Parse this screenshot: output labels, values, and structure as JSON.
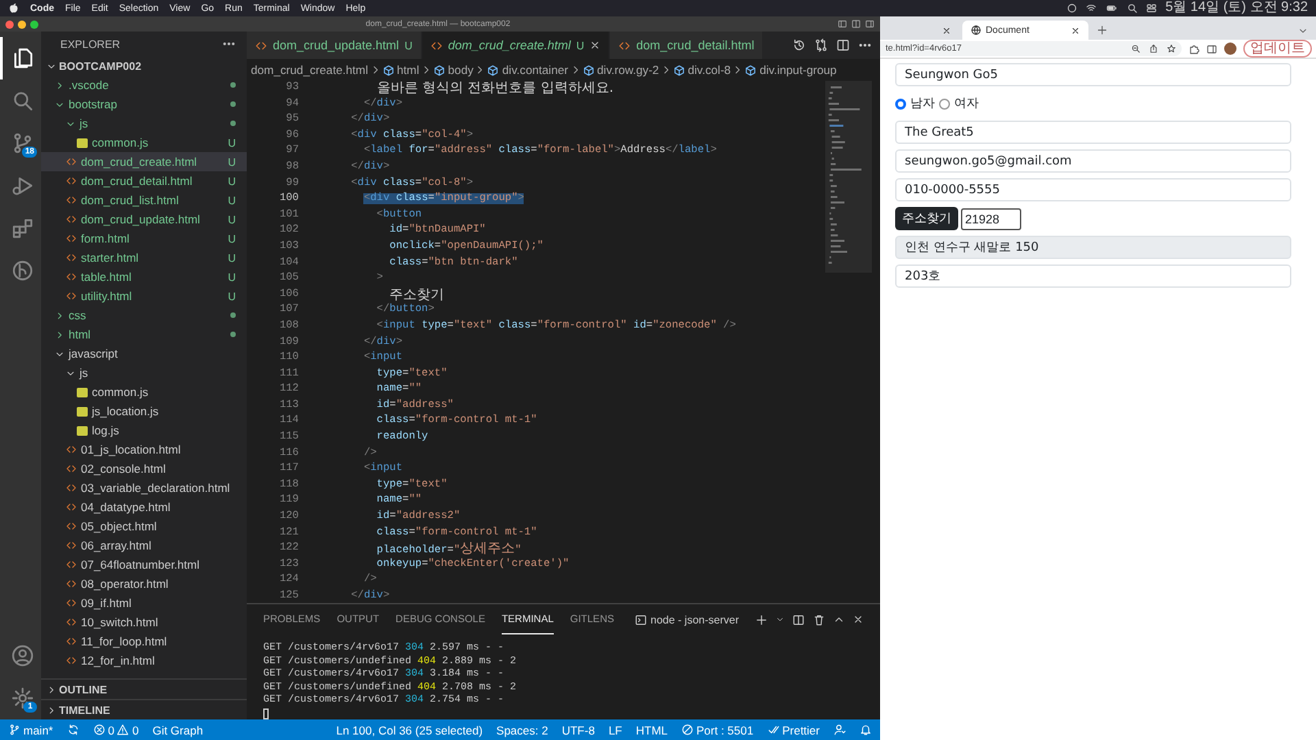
{
  "menubar": {
    "items": [
      "Code",
      "File",
      "Edit",
      "Selection",
      "View",
      "Go",
      "Run",
      "Terminal",
      "Window",
      "Help"
    ],
    "clock": "5월 14일 (토) 오전 9:32"
  },
  "window": {
    "title": "dom_crud_create.html — bootcamp002"
  },
  "activity_bar": {
    "items": [
      {
        "kind": "files",
        "selected": true
      },
      {
        "kind": "search",
        "selected": false
      },
      {
        "kind": "source-control",
        "selected": false,
        "badge": "18"
      },
      {
        "kind": "run",
        "selected": false
      },
      {
        "kind": "extensions",
        "selected": false
      },
      {
        "kind": "gitlens",
        "selected": false
      }
    ],
    "bottom": [
      {
        "kind": "account"
      },
      {
        "kind": "settings",
        "badge": "1"
      }
    ]
  },
  "sidebar": {
    "title": "EXPLORER",
    "root": "BOOTCAMP002",
    "tree": [
      {
        "name": ".vscode",
        "kind": "folder",
        "expanded": false,
        "dot": true,
        "selected": false
      },
      {
        "name": "bootstrap",
        "kind": "folder",
        "expanded": true,
        "dot": true,
        "selected": false,
        "children": [
          {
            "name": "js",
            "kind": "folder",
            "expanded": true,
            "dot": true,
            "selected": false,
            "children": [
              {
                "name": "common.js",
                "kind": "js",
                "badge": "U",
                "selected": false
              }
            ]
          },
          {
            "name": "dom_crud_create.html",
            "kind": "html",
            "badge": "U",
            "selected": true
          },
          {
            "name": "dom_crud_detail.html",
            "kind": "html",
            "badge": "U",
            "selected": false
          },
          {
            "name": "dom_crud_list.html",
            "kind": "html",
            "badge": "U",
            "selected": false
          },
          {
            "name": "dom_crud_update.html",
            "kind": "html",
            "badge": "U",
            "selected": false
          },
          {
            "name": "form.html",
            "kind": "html",
            "badge": "U",
            "selected": false
          },
          {
            "name": "starter.html",
            "kind": "html",
            "badge": "U",
            "selected": false
          },
          {
            "name": "table.html",
            "kind": "html",
            "badge": "U",
            "selected": false
          },
          {
            "name": "utility.html",
            "kind": "html",
            "badge": "U",
            "selected": false
          }
        ]
      },
      {
        "name": "css",
        "kind": "folder",
        "expanded": false,
        "dot": true,
        "selected": false
      },
      {
        "name": "html",
        "kind": "folder",
        "expanded": false,
        "dot": true,
        "selected": false
      },
      {
        "name": "javascript",
        "kind": "folder",
        "expanded": true,
        "selected": false,
        "children": [
          {
            "name": "js",
            "kind": "folder",
            "expanded": true,
            "selected": false,
            "children": [
              {
                "name": "common.js",
                "kind": "js",
                "selected": false
              },
              {
                "name": "js_location.js",
                "kind": "js",
                "selected": false
              },
              {
                "name": "log.js",
                "kind": "js",
                "selected": false
              }
            ]
          },
          {
            "name": "01_js_location.html",
            "kind": "html",
            "selected": false
          },
          {
            "name": "02_console.html",
            "kind": "html",
            "selected": false
          },
          {
            "name": "03_variable_declaration.html",
            "kind": "html",
            "selected": false
          },
          {
            "name": "04_datatype.html",
            "kind": "html",
            "selected": false
          },
          {
            "name": "05_object.html",
            "kind": "html",
            "selected": false
          },
          {
            "name": "06_array.html",
            "kind": "html",
            "selected": false
          },
          {
            "name": "07_64floatnumber.html",
            "kind": "html",
            "selected": false
          },
          {
            "name": "08_operator.html",
            "kind": "html",
            "selected": false
          },
          {
            "name": "09_if.html",
            "kind": "html",
            "selected": false
          },
          {
            "name": "10_switch.html",
            "kind": "html",
            "selected": false
          },
          {
            "name": "11_for_loop.html",
            "kind": "html",
            "selected": false
          },
          {
            "name": "12_for_in.html",
            "kind": "html",
            "selected": false
          }
        ]
      }
    ],
    "sections": [
      "OUTLINE",
      "TIMELINE"
    ]
  },
  "editor": {
    "tabs": [
      {
        "label": "dom_crud_update.html",
        "badge": "U",
        "preview": false,
        "selected": false
      },
      {
        "label": "dom_crud_create.html",
        "badge": "U",
        "preview": true,
        "selected": true
      },
      {
        "label": "dom_crud_detail.html",
        "preview": false,
        "selected": false
      }
    ],
    "breadcrumbs": [
      "dom_crud_create.html",
      "html",
      "body",
      "div.container",
      "div.row.gy-2",
      "div.col-8",
      "div.input-group"
    ],
    "lines": [
      {
        "number": "93",
        "selected": false,
        "segments": [
          {
            "kind": "text",
            "text": "          올바른 형식의 전화번호를 입력하세요."
          }
        ]
      },
      {
        "number": "94",
        "selected": false,
        "segments": [
          {
            "kind": "punct",
            "text": "        </"
          },
          {
            "kind": "tag",
            "text": "div"
          },
          {
            "kind": "punct",
            "text": ">"
          }
        ]
      },
      {
        "number": "95",
        "selected": false,
        "segments": [
          {
            "kind": "punct",
            "text": "      </"
          },
          {
            "kind": "tag",
            "text": "div"
          },
          {
            "kind": "punct",
            "text": ">"
          }
        ]
      },
      {
        "number": "96",
        "selected": false,
        "segments": [
          {
            "kind": "punct",
            "text": "      <"
          },
          {
            "kind": "tag",
            "text": "div"
          },
          {
            "kind": "attr",
            "text": " class"
          },
          {
            "kind": "text",
            "text": "="
          },
          {
            "kind": "string",
            "text": "\"col-4\""
          },
          {
            "kind": "punct",
            "text": ">"
          }
        ]
      },
      {
        "number": "97",
        "selected": false,
        "segments": [
          {
            "kind": "punct",
            "text": "        <"
          },
          {
            "kind": "tag",
            "text": "label"
          },
          {
            "kind": "attr",
            "text": " for"
          },
          {
            "kind": "text",
            "text": "="
          },
          {
            "kind": "string",
            "text": "\"address\""
          },
          {
            "kind": "attr",
            "text": " class"
          },
          {
            "kind": "text",
            "text": "="
          },
          {
            "kind": "string",
            "text": "\"form-label\""
          },
          {
            "kind": "punct",
            "text": ">"
          },
          {
            "kind": "text",
            "text": "Address"
          },
          {
            "kind": "punct",
            "text": "</"
          },
          {
            "kind": "tag",
            "text": "label"
          },
          {
            "kind": "punct",
            "text": ">"
          }
        ]
      },
      {
        "number": "98",
        "selected": false,
        "segments": [
          {
            "kind": "punct",
            "text": "      </"
          },
          {
            "kind": "tag",
            "text": "div"
          },
          {
            "kind": "punct",
            "text": ">"
          }
        ]
      },
      {
        "number": "99",
        "selected": false,
        "segments": [
          {
            "kind": "punct",
            "text": "      <"
          },
          {
            "kind": "tag",
            "text": "div"
          },
          {
            "kind": "attr",
            "text": " class"
          },
          {
            "kind": "text",
            "text": "="
          },
          {
            "kind": "string",
            "text": "\"col-8\""
          },
          {
            "kind": "punct",
            "text": ">"
          }
        ]
      },
      {
        "number": "100",
        "selected": true,
        "segments": [
          {
            "kind": "punct",
            "text": "        <"
          },
          {
            "kind": "tag",
            "text": "div"
          },
          {
            "kind": "attr",
            "text": " class"
          },
          {
            "kind": "text",
            "text": "="
          },
          {
            "kind": "string",
            "text": "\"input-group\""
          },
          {
            "kind": "punct",
            "text": ">"
          }
        ]
      },
      {
        "number": "101",
        "selected": false,
        "segments": [
          {
            "kind": "punct",
            "text": "          <"
          },
          {
            "kind": "tag",
            "text": "button"
          }
        ]
      },
      {
        "number": "102",
        "selected": false,
        "segments": [
          {
            "kind": "attr",
            "text": "            id"
          },
          {
            "kind": "text",
            "text": "="
          },
          {
            "kind": "string",
            "text": "\"btnDaumAPI\""
          }
        ]
      },
      {
        "number": "103",
        "selected": false,
        "segments": [
          {
            "kind": "attr",
            "text": "            onclick"
          },
          {
            "kind": "text",
            "text": "="
          },
          {
            "kind": "string",
            "text": "\"openDaumAPI();\""
          }
        ]
      },
      {
        "number": "104",
        "selected": false,
        "segments": [
          {
            "kind": "attr",
            "text": "            class"
          },
          {
            "kind": "text",
            "text": "="
          },
          {
            "kind": "string",
            "text": "\"btn btn-dark\""
          }
        ]
      },
      {
        "number": "105",
        "selected": false,
        "segments": [
          {
            "kind": "punct",
            "text": "          >"
          }
        ]
      },
      {
        "number": "106",
        "selected": false,
        "segments": [
          {
            "kind": "text",
            "text": "            주소찾기"
          }
        ]
      },
      {
        "number": "107",
        "selected": false,
        "segments": [
          {
            "kind": "punct",
            "text": "          </"
          },
          {
            "kind": "tag",
            "text": "button"
          },
          {
            "kind": "punct",
            "text": ">"
          }
        ]
      },
      {
        "number": "108",
        "selected": false,
        "segments": [
          {
            "kind": "punct",
            "text": "          <"
          },
          {
            "kind": "tag",
            "text": "input"
          },
          {
            "kind": "attr",
            "text": " type"
          },
          {
            "kind": "text",
            "text": "="
          },
          {
            "kind": "string",
            "text": "\"text\""
          },
          {
            "kind": "attr",
            "text": " class"
          },
          {
            "kind": "text",
            "text": "="
          },
          {
            "kind": "string",
            "text": "\"form-control\""
          },
          {
            "kind": "attr",
            "text": " id"
          },
          {
            "kind": "text",
            "text": "="
          },
          {
            "kind": "string",
            "text": "\"zonecode\""
          },
          {
            "kind": "punct",
            "text": " />"
          }
        ]
      },
      {
        "number": "109",
        "selected": false,
        "segments": [
          {
            "kind": "punct",
            "text": "        </"
          },
          {
            "kind": "tag",
            "text": "div"
          },
          {
            "kind": "punct",
            "text": ">"
          }
        ]
      },
      {
        "number": "110",
        "selected": false,
        "segments": [
          {
            "kind": "punct",
            "text": "        <"
          },
          {
            "kind": "tag",
            "text": "input"
          }
        ]
      },
      {
        "number": "111",
        "selected": false,
        "segments": [
          {
            "kind": "attr",
            "text": "          type"
          },
          {
            "kind": "text",
            "text": "="
          },
          {
            "kind": "string",
            "text": "\"text\""
          }
        ]
      },
      {
        "number": "112",
        "selected": false,
        "segments": [
          {
            "kind": "attr",
            "text": "          name"
          },
          {
            "kind": "text",
            "text": "="
          },
          {
            "kind": "string",
            "text": "\"\""
          }
        ]
      },
      {
        "number": "113",
        "selected": false,
        "segments": [
          {
            "kind": "attr",
            "text": "          id"
          },
          {
            "kind": "text",
            "text": "="
          },
          {
            "kind": "string",
            "text": "\"address\""
          }
        ]
      },
      {
        "number": "114",
        "selected": false,
        "segments": [
          {
            "kind": "attr",
            "text": "          class"
          },
          {
            "kind": "text",
            "text": "="
          },
          {
            "kind": "string",
            "text": "\"form-control mt-1\""
          }
        ]
      },
      {
        "number": "115",
        "selected": false,
        "segments": [
          {
            "kind": "attr",
            "text": "          readonly"
          }
        ]
      },
      {
        "number": "116",
        "selected": false,
        "segments": [
          {
            "kind": "punct",
            "text": "        />"
          }
        ]
      },
      {
        "number": "117",
        "selected": false,
        "segments": [
          {
            "kind": "punct",
            "text": "        <"
          },
          {
            "kind": "tag",
            "text": "input"
          }
        ]
      },
      {
        "number": "118",
        "selected": false,
        "segments": [
          {
            "kind": "attr",
            "text": "          type"
          },
          {
            "kind": "text",
            "text": "="
          },
          {
            "kind": "string",
            "text": "\"text\""
          }
        ]
      },
      {
        "number": "119",
        "selected": false,
        "segments": [
          {
            "kind": "attr",
            "text": "          name"
          },
          {
            "kind": "text",
            "text": "="
          },
          {
            "kind": "string",
            "text": "\"\""
          }
        ]
      },
      {
        "number": "120",
        "selected": false,
        "segments": [
          {
            "kind": "attr",
            "text": "          id"
          },
          {
            "kind": "text",
            "text": "="
          },
          {
            "kind": "string",
            "text": "\"address2\""
          }
        ]
      },
      {
        "number": "121",
        "selected": false,
        "segments": [
          {
            "kind": "attr",
            "text": "          class"
          },
          {
            "kind": "text",
            "text": "="
          },
          {
            "kind": "string",
            "text": "\"form-control mt-1\""
          }
        ]
      },
      {
        "number": "122",
        "selected": false,
        "segments": [
          {
            "kind": "attr",
            "text": "          placeholder"
          },
          {
            "kind": "text",
            "text": "="
          },
          {
            "kind": "string",
            "text": "\"상세주소\""
          }
        ]
      },
      {
        "number": "123",
        "selected": false,
        "segments": [
          {
            "kind": "attr",
            "text": "          onkeyup"
          },
          {
            "kind": "text",
            "text": "="
          },
          {
            "kind": "string",
            "text": "\"checkEnter('create')\""
          }
        ]
      },
      {
        "number": "124",
        "selected": false,
        "segments": [
          {
            "kind": "punct",
            "text": "        />"
          }
        ]
      },
      {
        "number": "125",
        "selected": false,
        "segments": [
          {
            "kind": "punct",
            "text": "      </"
          },
          {
            "kind": "tag",
            "text": "div"
          },
          {
            "kind": "punct",
            "text": ">"
          }
        ]
      }
    ]
  },
  "panel": {
    "tabs": [
      {
        "label": "PROBLEMS",
        "selected": false
      },
      {
        "label": "OUTPUT",
        "selected": false
      },
      {
        "label": "DEBUG CONSOLE",
        "selected": false
      },
      {
        "label": "TERMINAL",
        "selected": true
      },
      {
        "label": "GITLENS",
        "selected": false
      }
    ],
    "terminal_name": "node - json-server",
    "lines": [
      {
        "segments": [
          {
            "kind": "plain",
            "text": "GET /customers/4rv6o17 "
          },
          {
            "kind": "info",
            "text": "304"
          },
          {
            "kind": "plain",
            "text": " 2.597 ms - -"
          }
        ]
      },
      {
        "segments": [
          {
            "kind": "plain",
            "text": "GET /customers/undefined "
          },
          {
            "kind": "warn",
            "text": "404"
          },
          {
            "kind": "plain",
            "text": " 2.889 ms - 2"
          }
        ]
      },
      {
        "segments": [
          {
            "kind": "plain",
            "text": "GET /customers/4rv6o17 "
          },
          {
            "kind": "info",
            "text": "304"
          },
          {
            "kind": "plain",
            "text": " 3.184 ms - -"
          }
        ]
      },
      {
        "segments": [
          {
            "kind": "plain",
            "text": "GET /customers/undefined "
          },
          {
            "kind": "warn",
            "text": "404"
          },
          {
            "kind": "plain",
            "text": " 2.708 ms - 2"
          }
        ]
      },
      {
        "segments": [
          {
            "kind": "plain",
            "text": "GET /customers/4rv6o17 "
          },
          {
            "kind": "info",
            "text": "304"
          },
          {
            "kind": "plain",
            "text": " 2.754 ms - -"
          }
        ]
      }
    ]
  },
  "status_bar": {
    "branch": "main*",
    "errors": "0",
    "warnings": "0",
    "git_graph": "Git Graph",
    "position": "Ln 100, Col 36 (25 selected)",
    "spaces": "Spaces: 2",
    "encoding": "UTF-8",
    "eol": "LF",
    "language": "HTML",
    "port": "Port : 5501",
    "formatter": "Prettier"
  },
  "browser": {
    "tabs": [
      {
        "selected": false
      },
      {
        "label": "Document",
        "selected": true
      }
    ],
    "url": "te.html?id=4rv6o17",
    "update_button": "업데이트",
    "form": [
      {
        "kind": "input",
        "value": "Seungwon Go5"
      },
      {
        "kind": "radio",
        "options": [
          {
            "label": "남자",
            "selected": true
          },
          {
            "label": "여자",
            "selected": false
          }
        ]
      },
      {
        "kind": "input",
        "value": "The Great5"
      },
      {
        "kind": "input",
        "value": "seungwon.go5@gmail.com"
      },
      {
        "kind": "input",
        "value": "010-0000-5555"
      },
      {
        "kind": "zip",
        "button": "주소찾기",
        "value": "21928"
      },
      {
        "kind": "readonly",
        "value": "인천 연수구 새말로 150"
      },
      {
        "kind": "input",
        "value": "203호"
      }
    ]
  }
}
